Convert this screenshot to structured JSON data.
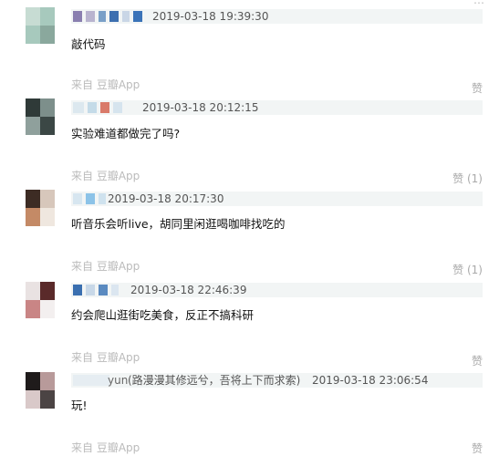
{
  "comments": [
    {
      "timestamp": "2019-03-18 19:39:30",
      "content": "敲代码",
      "source": "来自 豆瓣App",
      "like": "赞"
    },
    {
      "timestamp": "2019-03-18 20:12:15",
      "content": "实验难道都做完了吗?",
      "source": "来自 豆瓣App",
      "like": "赞 (1)"
    },
    {
      "timestamp": "2019-03-18 20:17:30",
      "content": "听音乐会听live，胡同里闲逛喝咖啡找吃的",
      "source": "来自 豆瓣App",
      "like": "赞 (1)"
    },
    {
      "timestamp": "2019-03-18 22:46:39",
      "content": "约会爬山逛街吃美食，反正不搞科研",
      "source": "来自 豆瓣App",
      "like": "赞"
    },
    {
      "handle_suffix": "yun",
      "signature": "(路漫漫其修远兮，吾将上下而求索)",
      "timestamp": "2019-03-18 23:06:54",
      "content": "玩!",
      "source": "来自 豆瓣App",
      "like": "赞"
    }
  ]
}
